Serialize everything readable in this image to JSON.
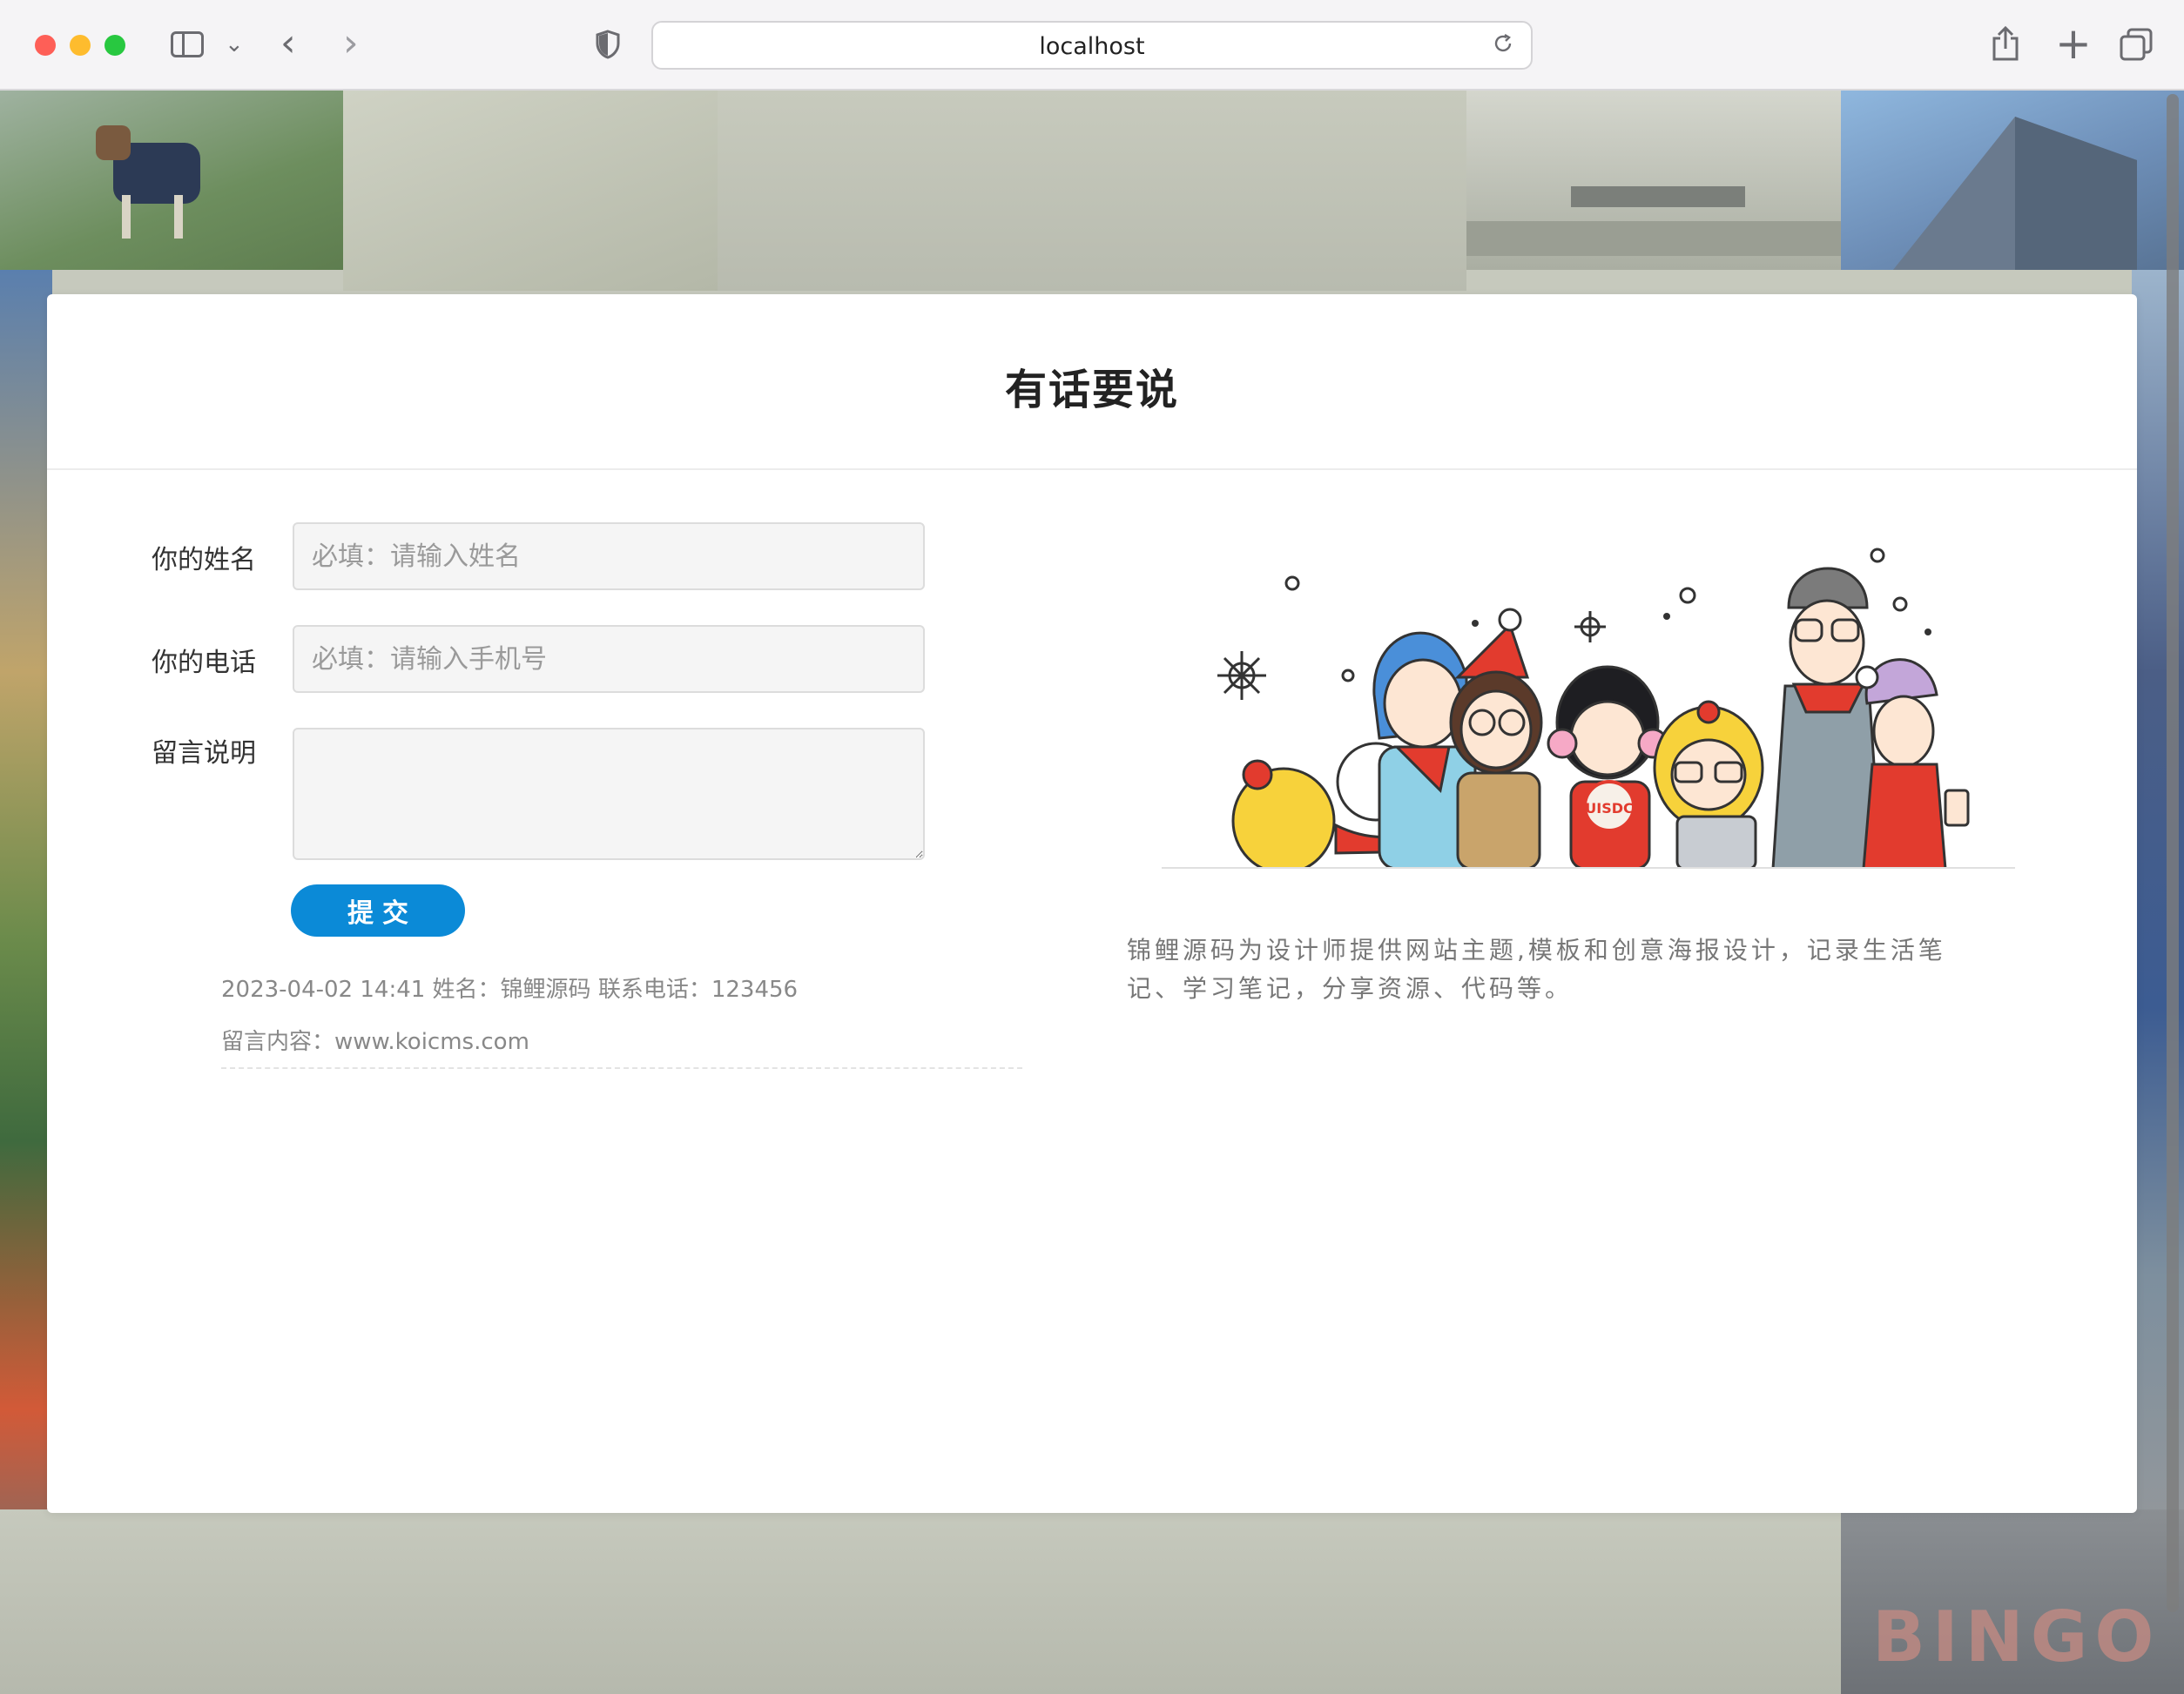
{
  "browser": {
    "url": "localhost"
  },
  "page": {
    "title": "有话要说",
    "form": {
      "name_label": "你的姓名",
      "name_placeholder": "必填：请输入姓名",
      "phone_label": "你的电话",
      "phone_placeholder": "必填：请输入手机号",
      "message_label": "留言说明",
      "message_value": "",
      "submit_label": "提交"
    },
    "messages": [
      {
        "header": "2023-04-02 14:41 姓名：锦鲤源码 联系电话：123456",
        "content": "留言内容：www.koicms.com"
      }
    ],
    "description": "锦鲤源码为设计师提供网站主题,模板和创意海报设计，记录生活笔记、学习笔记，分享资源、代码等。",
    "illustration_badge": "UISDC"
  },
  "background": {
    "sign_text": "BINGO"
  },
  "colors": {
    "accent": "#0b8ad7",
    "traffic_red": "#fe5f57",
    "traffic_yellow": "#febc2e",
    "traffic_green": "#28c840"
  },
  "icons": [
    "sidebar-icon",
    "chevron-down-icon",
    "back-icon",
    "forward-icon",
    "shield-icon",
    "reload-icon",
    "share-icon",
    "plus-icon",
    "tabs-icon"
  ]
}
